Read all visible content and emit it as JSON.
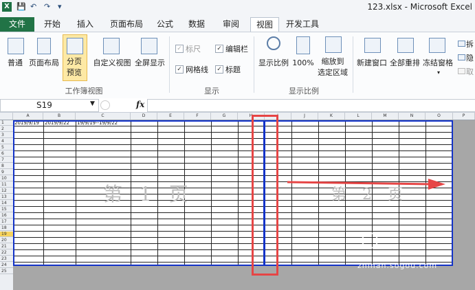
{
  "window": {
    "title": "123.xlsx - Microsoft Excel",
    "app_icon": "X"
  },
  "quick_access": [
    "save-icon",
    "undo-icon",
    "redo-icon",
    "customize-icon"
  ],
  "tabs": [
    {
      "label": "文件",
      "file": true
    },
    {
      "label": "开始"
    },
    {
      "label": "插入"
    },
    {
      "label": "页面布局"
    },
    {
      "label": "公式"
    },
    {
      "label": "数据"
    },
    {
      "label": "审阅"
    },
    {
      "label": "视图",
      "active": true
    },
    {
      "label": "开发工具"
    }
  ],
  "ribbon": {
    "workbook_views": {
      "group_name": "工作簿视图",
      "normal": "普通",
      "page_layout": "页面布局",
      "page_break_preview_l1": "分页",
      "page_break_preview_l2": "预览",
      "custom_views": "自定义视图",
      "full_screen": "全屏显示"
    },
    "show": {
      "group_name": "显示",
      "ruler": "标尺",
      "formula_bar": "编辑栏",
      "gridlines": "网格线",
      "headings": "标题"
    },
    "zoom": {
      "group_name": "显示比例",
      "zoom": "显示比例",
      "zoom_100": "100%",
      "zoom_selection_l1": "缩放到",
      "zoom_selection_l2": "选定区域"
    },
    "window": {
      "new_window": "新建窗口",
      "arrange_all": "全部重排",
      "freeze_panes": "冻结窗格",
      "split": "拆",
      "hide": "隐",
      "unhide": "取"
    }
  },
  "formula_bar": {
    "name_box": "S19",
    "fx": "fx",
    "content": ""
  },
  "sheet": {
    "columns": [
      "A",
      "B",
      "C",
      "D",
      "E",
      "F",
      "G",
      "H",
      "I",
      "J",
      "K",
      "L",
      "M",
      "N",
      "O",
      "P"
    ],
    "rows": [
      "1",
      "2",
      "3",
      "4",
      "5",
      "6",
      "7",
      "8",
      "9",
      "10",
      "11",
      "12",
      "13",
      "14",
      "15",
      "16",
      "17",
      "18",
      "19",
      "20",
      "21",
      "22",
      "23",
      "24",
      "25"
    ],
    "selected_row": "19",
    "cells": {
      "A1": "2019/9/19",
      "B1": "2019/9/22",
      "C1": "19/9/19--19/9/22"
    },
    "page1_watermark": "第 1 页",
    "page2_watermark": "第 2 页"
  },
  "overlay": {
    "watermark_text": "zhihan.sogou.com"
  }
}
